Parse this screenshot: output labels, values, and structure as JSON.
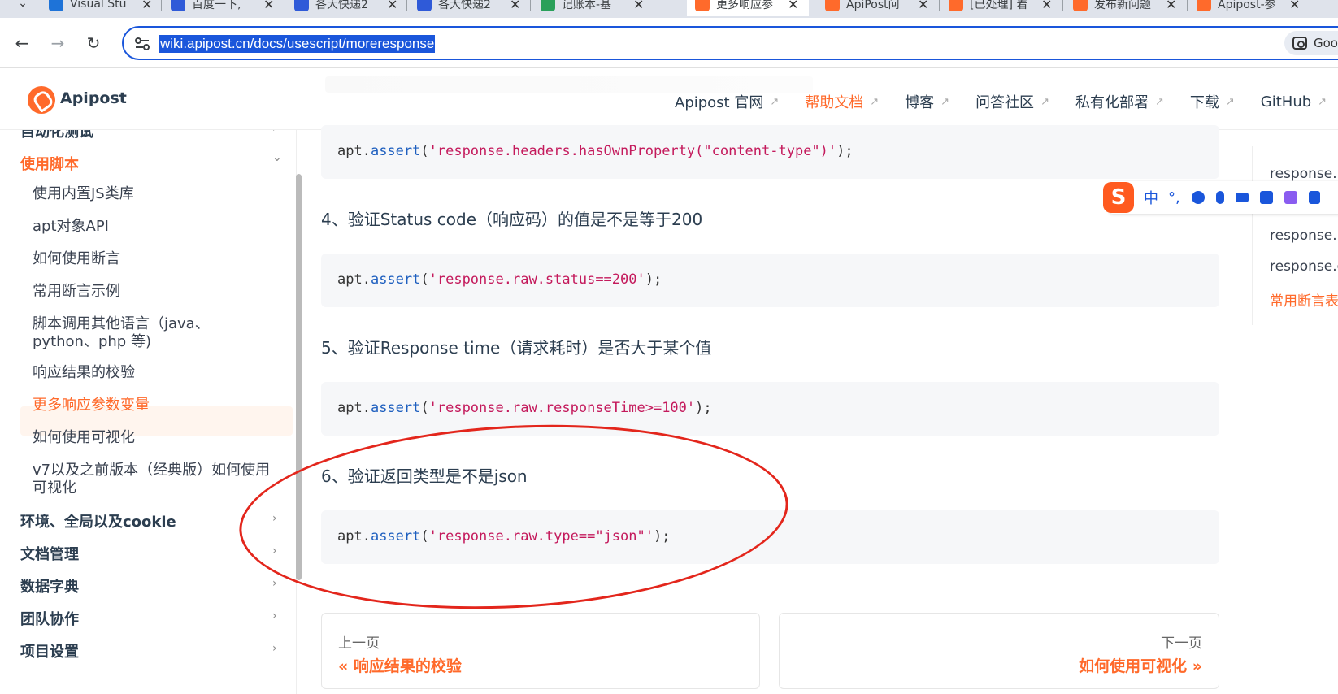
{
  "browser": {
    "tabs": [
      {
        "label": "Visual Stu",
        "color": "#1e73d8"
      },
      {
        "label": "百度一下,",
        "color": "#2f5ad8"
      },
      {
        "label": "各大快递2",
        "color": "#2f5ad8"
      },
      {
        "label": "各大快递2",
        "color": "#2f5ad8"
      },
      {
        "label": "记账本-基",
        "color": "#2aa05a"
      },
      {
        "label": "更多响应参",
        "color": "#ff6a2b"
      },
      {
        "label": "ApiPost问",
        "color": "#ff6a2b"
      },
      {
        "label": "[已处理] 着",
        "color": "#ff6a2b"
      },
      {
        "label": "发布新问题",
        "color": "#ff6a2b"
      },
      {
        "label": "Apipost-参",
        "color": "#ff6a2b"
      }
    ],
    "close_glyph": "✕",
    "tab_dropdown_glyph": "⌄",
    "back_glyph": "←",
    "forward_glyph": "→",
    "reload_glyph": "↻",
    "url": "wiki.apipost.cn/docs/usescript/moreresponse",
    "google_lens_label": "Goo"
  },
  "site": {
    "brand": "Apipost",
    "nav": [
      {
        "label": "Apipost 官网",
        "arrow": "↗",
        "active": false
      },
      {
        "label": "帮助文档",
        "arrow": "↗",
        "active": true
      },
      {
        "label": "博客",
        "arrow": "↗",
        "active": false
      },
      {
        "label": "问答社区",
        "arrow": "↗",
        "active": false
      },
      {
        "label": "私有化部署",
        "arrow": "↗",
        "active": false
      },
      {
        "label": "下载",
        "arrow": "↗",
        "active": false
      },
      {
        "label": "GitHub",
        "arrow": "↗",
        "active": false
      }
    ]
  },
  "sidebar": {
    "groups": [
      {
        "label": "自动化测试",
        "chevron": "›"
      },
      {
        "label": "使用脚本",
        "chevron": "⌄"
      },
      {
        "label": "环境、全局以及cookie",
        "chevron": "›"
      },
      {
        "label": "文档管理",
        "chevron": "›"
      },
      {
        "label": "数据字典",
        "chevron": "›"
      },
      {
        "label": "团队协作",
        "chevron": "›"
      },
      {
        "label": "项目设置",
        "chevron": "›"
      }
    ],
    "items": [
      "使用内置JS类库",
      "apt对象API",
      "如何使用断言",
      "常用断言示例",
      "脚本调用其他语言（java、python、php 等)",
      "响应结果的校验",
      "更多响应参数变量",
      "如何使用可视化",
      "v7以及之前版本（经典版）如何使用可视化"
    ]
  },
  "content": {
    "code1": {
      "obj": "apt.",
      "fn": "assert",
      "open": "(",
      "str": "'response.headers.hasOwnProperty(\"content-type\")'",
      "close": ");"
    },
    "heading4": "4、验证Status code（响应码）的值是不是等于200",
    "code4": {
      "obj": "apt.",
      "fn": "assert",
      "open": "(",
      "str": "'response.raw.status==200'",
      "close": ");"
    },
    "heading5": "5、验证Response time（请求耗时）是否大于某个值",
    "code5": {
      "obj": "apt.",
      "fn": "assert",
      "open": "(",
      "str": "'response.raw.responseTime>=100'",
      "close": ");"
    },
    "heading6": "6、验证返回类型是不是json",
    "code6": {
      "obj": "apt.",
      "fn": "assert",
      "open": "(",
      "str": "'response.raw.type==\"json\"'",
      "close": ");"
    }
  },
  "pager": {
    "prev_label": "上一页",
    "prev_title": "« 响应结果的校验",
    "next_label": "下一页",
    "next_title": "如何使用可视化 »"
  },
  "toc": [
    "response.r",
    "response.h",
    "response.c",
    "常用断言表"
  ],
  "ime": {
    "logo": "S",
    "mode": "中",
    "punct": "°,"
  },
  "annotation_color": "#e3261c",
  "accent_color": "#ff6a2b"
}
